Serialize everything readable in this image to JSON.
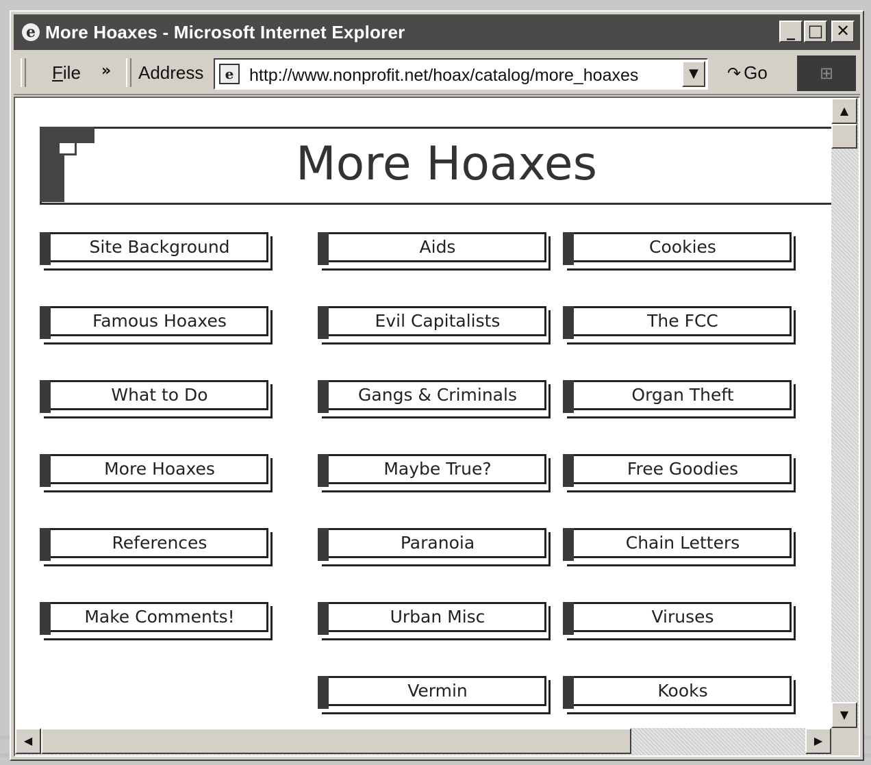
{
  "window": {
    "title": "More Hoaxes - Microsoft Internet Explorer",
    "controls": {
      "minimize": "_",
      "maximize": "□",
      "close": "✕"
    }
  },
  "toolbar": {
    "file_menu_prefix": "F",
    "file_menu_rest": "ile",
    "more": "»",
    "address_label": "Address",
    "url": "http://www.nonprofit.net/hoax/catalog/more_hoaxes",
    "go_label": "Go"
  },
  "page": {
    "title": "More Hoaxes",
    "nav": [
      {
        "label": "Site Background"
      },
      {
        "label": "Aids"
      },
      {
        "label": "Cookies"
      },
      {
        "label": "Famous Hoaxes"
      },
      {
        "label": "Evil Capitalists"
      },
      {
        "label": "The FCC"
      },
      {
        "label": "What to Do"
      },
      {
        "label": "Gangs & Criminals"
      },
      {
        "label": "Organ Theft"
      },
      {
        "label": "More Hoaxes"
      },
      {
        "label": "Maybe True?"
      },
      {
        "label": "Free Goodies"
      },
      {
        "label": "References"
      },
      {
        "label": "Paranoia"
      },
      {
        "label": "Chain Letters"
      },
      {
        "label": "Make Comments!"
      },
      {
        "label": "Urban Misc"
      },
      {
        "label": "Viruses"
      },
      {
        "label": "Vermin"
      },
      {
        "label": "Kooks"
      }
    ]
  }
}
